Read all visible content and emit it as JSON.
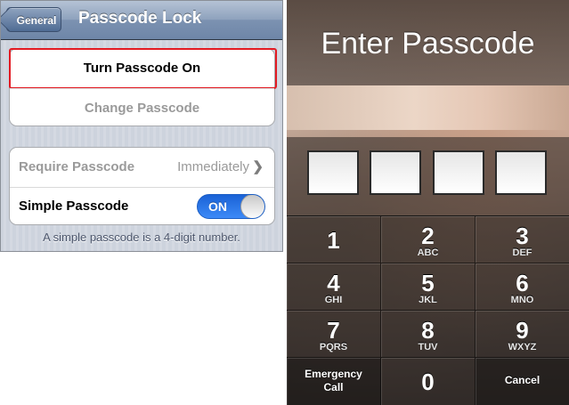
{
  "settings": {
    "back_label": "General",
    "title": "Passcode Lock",
    "turn_on_label": "Turn Passcode On",
    "change_label": "Change Passcode",
    "require_label": "Require Passcode",
    "require_value": "Immediately",
    "chevron_icon": "chevron-right-icon",
    "simple_label": "Simple Passcode",
    "toggle_state": "ON",
    "footnote": "A simple passcode is a 4-digit number.",
    "highlight_color": "#e31b23",
    "toggle_color": "#2f7cec"
  },
  "passcode": {
    "title": "Enter Passcode",
    "keys": [
      {
        "digit": "1",
        "letters": ""
      },
      {
        "digit": "2",
        "letters": "ABC"
      },
      {
        "digit": "3",
        "letters": "DEF"
      },
      {
        "digit": "4",
        "letters": "GHI"
      },
      {
        "digit": "5",
        "letters": "JKL"
      },
      {
        "digit": "6",
        "letters": "MNO"
      },
      {
        "digit": "7",
        "letters": "PQRS"
      },
      {
        "digit": "8",
        "letters": "TUV"
      },
      {
        "digit": "9",
        "letters": "WXYZ"
      },
      {
        "digit": "0",
        "letters": ""
      }
    ],
    "emergency_line1": "Emergency",
    "emergency_line2": "Call",
    "cancel_label": "Cancel"
  }
}
